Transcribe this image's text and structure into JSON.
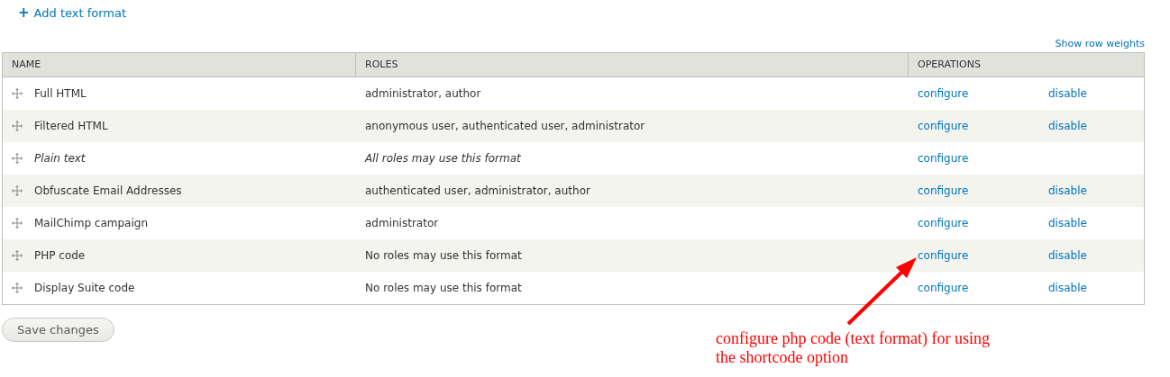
{
  "add_link": {
    "icon": "+",
    "label": "Add text format"
  },
  "show_weights_link": "Show row weights",
  "table": {
    "columns": [
      "NAME",
      "ROLES",
      "OPERATIONS"
    ],
    "rows": [
      {
        "name": "Full HTML",
        "roles": "administrator, author",
        "italic": false,
        "operations": [
          "configure",
          "disable"
        ]
      },
      {
        "name": "Filtered HTML",
        "roles": "anonymous user, authenticated user, administrator",
        "italic": false,
        "operations": [
          "configure",
          "disable"
        ]
      },
      {
        "name": "Plain text",
        "roles": "All roles may use this format",
        "italic": true,
        "operations": [
          "configure"
        ]
      },
      {
        "name": "Obfuscate Email Addresses",
        "roles": "authenticated user, administrator, author",
        "italic": false,
        "operations": [
          "configure",
          "disable"
        ]
      },
      {
        "name": "MailChimp campaign",
        "roles": "administrator",
        "italic": false,
        "operations": [
          "configure",
          "disable"
        ]
      },
      {
        "name": "PHP code",
        "roles": "No roles may use this format",
        "italic": false,
        "operations": [
          "configure",
          "disable"
        ]
      },
      {
        "name": "Display Suite code",
        "roles": "No roles may use this format",
        "italic": false,
        "operations": [
          "configure",
          "disable"
        ]
      }
    ]
  },
  "save_button": "Save changes",
  "annotation": "configure php code (text format) for using the shortcode option"
}
